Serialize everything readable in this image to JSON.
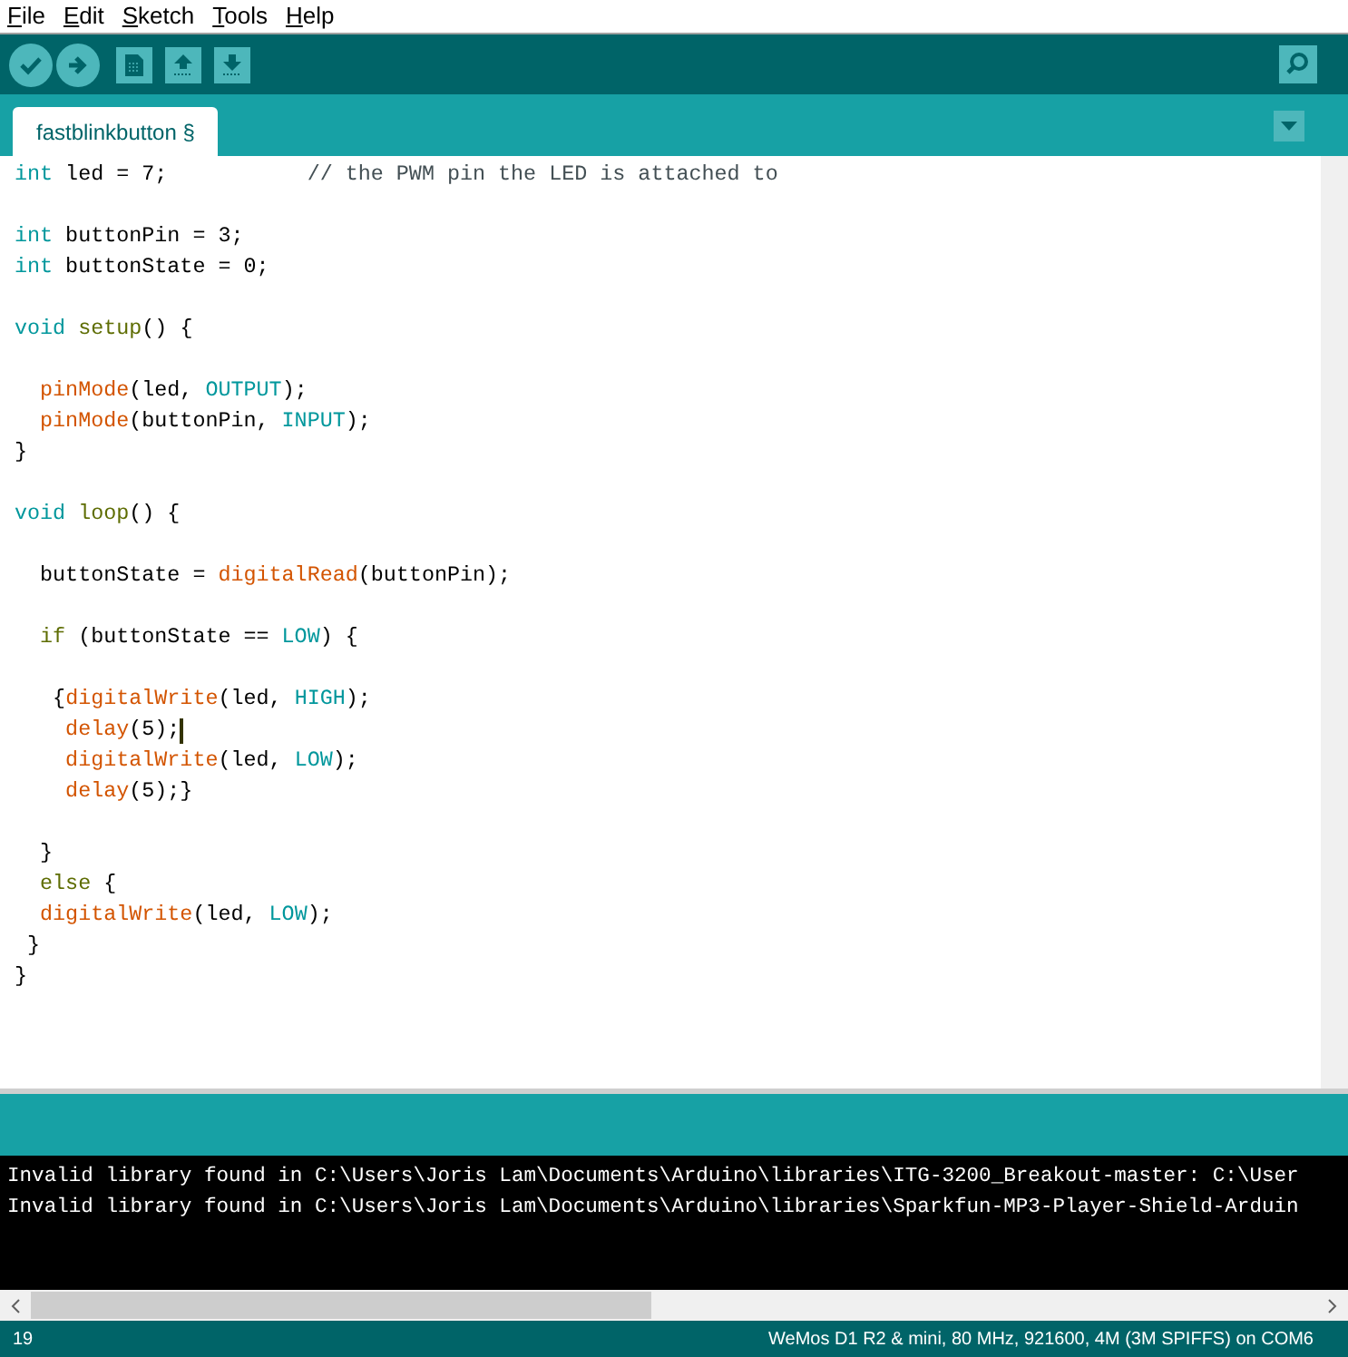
{
  "menu": [
    {
      "label": "File"
    },
    {
      "label": "Edit"
    },
    {
      "label": "Sketch"
    },
    {
      "label": "Tools"
    },
    {
      "label": "Help"
    }
  ],
  "toolbar": {
    "buttons": [
      {
        "kind": "verify"
      },
      {
        "kind": "upload"
      },
      {
        "kind": "new"
      },
      {
        "kind": "open"
      },
      {
        "kind": "save"
      }
    ]
  },
  "tabs": [
    {
      "label": "fastblinkbutton §",
      "selected": true
    }
  ],
  "editor": {
    "lines": [
      {
        "kind": "code",
        "tokens": [
          {
            "kind": "type",
            "text": "int"
          },
          {
            "kind": "plain",
            "text": " led = 7;           "
          },
          {
            "kind": "comment",
            "text": "// the PWM pin the LED is attached to"
          }
        ]
      },
      {
        "kind": "blank"
      },
      {
        "kind": "code",
        "tokens": [
          {
            "kind": "type",
            "text": "int"
          },
          {
            "kind": "plain",
            "text": " buttonPin = 3;"
          }
        ]
      },
      {
        "kind": "code",
        "tokens": [
          {
            "kind": "type",
            "text": "int"
          },
          {
            "kind": "plain",
            "text": " buttonState = 0;"
          }
        ]
      },
      {
        "kind": "blank"
      },
      {
        "kind": "code",
        "tokens": [
          {
            "kind": "type",
            "text": "void "
          },
          {
            "kind": "keyword",
            "text": "setup"
          },
          {
            "kind": "plain",
            "text": "() {"
          }
        ]
      },
      {
        "kind": "blank"
      },
      {
        "kind": "code",
        "tokens": [
          {
            "kind": "function",
            "text": "  pinMode"
          },
          {
            "kind": "plain",
            "text": "(led, "
          },
          {
            "kind": "constant",
            "text": "OUTPUT"
          },
          {
            "kind": "plain",
            "text": ");"
          }
        ]
      },
      {
        "kind": "code",
        "tokens": [
          {
            "kind": "function",
            "text": "  pinMode"
          },
          {
            "kind": "plain",
            "text": "(buttonPin, "
          },
          {
            "kind": "constant",
            "text": "INPUT"
          },
          {
            "kind": "plain",
            "text": ");"
          }
        ]
      },
      {
        "kind": "code",
        "tokens": [
          {
            "kind": "plain",
            "text": "}"
          }
        ]
      },
      {
        "kind": "blank"
      },
      {
        "kind": "code",
        "tokens": [
          {
            "kind": "type",
            "text": "void "
          },
          {
            "kind": "keyword",
            "text": "loop"
          },
          {
            "kind": "plain",
            "text": "() {"
          }
        ]
      },
      {
        "kind": "blank"
      },
      {
        "kind": "code",
        "tokens": [
          {
            "kind": "plain",
            "text": "  buttonState = "
          },
          {
            "kind": "function",
            "text": "digitalRead"
          },
          {
            "kind": "plain",
            "text": "(buttonPin);"
          }
        ]
      },
      {
        "kind": "blank"
      },
      {
        "kind": "code",
        "tokens": [
          {
            "kind": "keyword",
            "text": "  if"
          },
          {
            "kind": "plain",
            "text": " (buttonState == "
          },
          {
            "kind": "constant",
            "text": "LOW"
          },
          {
            "kind": "plain",
            "text": ") {"
          }
        ]
      },
      {
        "kind": "blank"
      },
      {
        "kind": "code",
        "tokens": [
          {
            "kind": "plain",
            "text": "   {"
          },
          {
            "kind": "function",
            "text": "digitalWrite"
          },
          {
            "kind": "plain",
            "text": "(led, "
          },
          {
            "kind": "constant",
            "text": "HIGH"
          },
          {
            "kind": "plain",
            "text": ");"
          }
        ]
      },
      {
        "kind": "code",
        "tokens": [
          {
            "kind": "function",
            "text": "    delay"
          },
          {
            "kind": "plain",
            "text": "(5);"
          },
          {
            "kind": "cursor"
          }
        ]
      },
      {
        "kind": "code",
        "tokens": [
          {
            "kind": "function",
            "text": "    digitalWrite"
          },
          {
            "kind": "plain",
            "text": "(led, "
          },
          {
            "kind": "constant",
            "text": "LOW"
          },
          {
            "kind": "plain",
            "text": ");"
          }
        ]
      },
      {
        "kind": "code",
        "tokens": [
          {
            "kind": "function",
            "text": "    delay"
          },
          {
            "kind": "plain",
            "text": "(5);}"
          }
        ]
      },
      {
        "kind": "blank"
      },
      {
        "kind": "code",
        "tokens": [
          {
            "kind": "plain",
            "text": "  }"
          }
        ]
      },
      {
        "kind": "code",
        "tokens": [
          {
            "kind": "keyword",
            "text": "  else"
          },
          {
            "kind": "plain",
            "text": " {"
          }
        ]
      },
      {
        "kind": "code",
        "tokens": [
          {
            "kind": "function",
            "text": "  digitalWrite"
          },
          {
            "kind": "plain",
            "text": "(led, "
          },
          {
            "kind": "constant",
            "text": "LOW"
          },
          {
            "kind": "plain",
            "text": ");"
          }
        ]
      },
      {
        "kind": "code",
        "tokens": [
          {
            "kind": "plain",
            "text": " }"
          }
        ]
      },
      {
        "kind": "code",
        "tokens": [
          {
            "kind": "plain",
            "text": "}"
          }
        ]
      }
    ]
  },
  "console": {
    "lines": [
      "Invalid library found in C:\\Users\\Joris Lam\\Documents\\Arduino\\libraries\\ITG-3200_Breakout-master: C:\\User",
      "Invalid library found in C:\\Users\\Joris Lam\\Documents\\Arduino\\libraries\\Sparkfun-MP3-Player-Shield-Arduin"
    ]
  },
  "status_bar": {
    "line": "19",
    "board": "WeMos D1 R2 & mini, 80 MHz, 921600, 4M (3M SPIFFS) on COM6"
  }
}
